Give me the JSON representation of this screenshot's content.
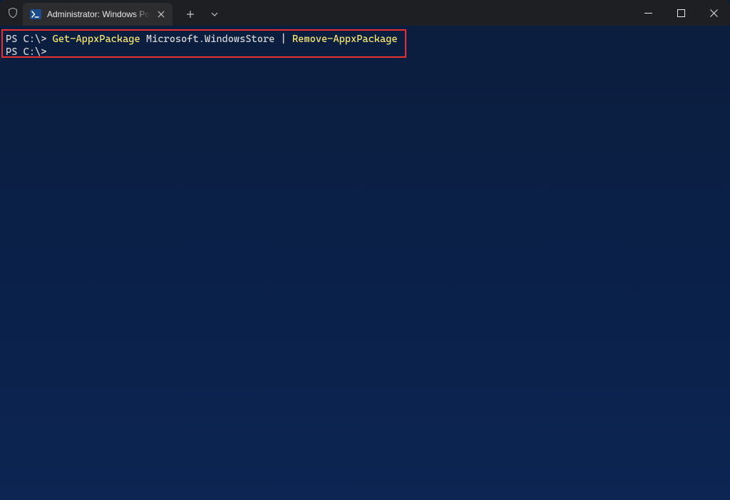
{
  "titlebar": {
    "tab_title": "Administrator: Windows PowerShell",
    "tab_icon_alt": "powershell-icon"
  },
  "terminal": {
    "lines": [
      {
        "prompt": "PS C:\\> ",
        "segments": [
          {
            "cls": "ps-cmd",
            "text": "Get-AppxPackage"
          },
          {
            "cls": "ps-arg",
            "text": " Microsoft.WindowsStore "
          },
          {
            "cls": "ps-pipe",
            "text": "|"
          },
          {
            "cls": "ps-cmd",
            "text": " Remove-AppxPackage"
          }
        ]
      },
      {
        "prompt": "PS C:\\>",
        "segments": []
      }
    ]
  }
}
